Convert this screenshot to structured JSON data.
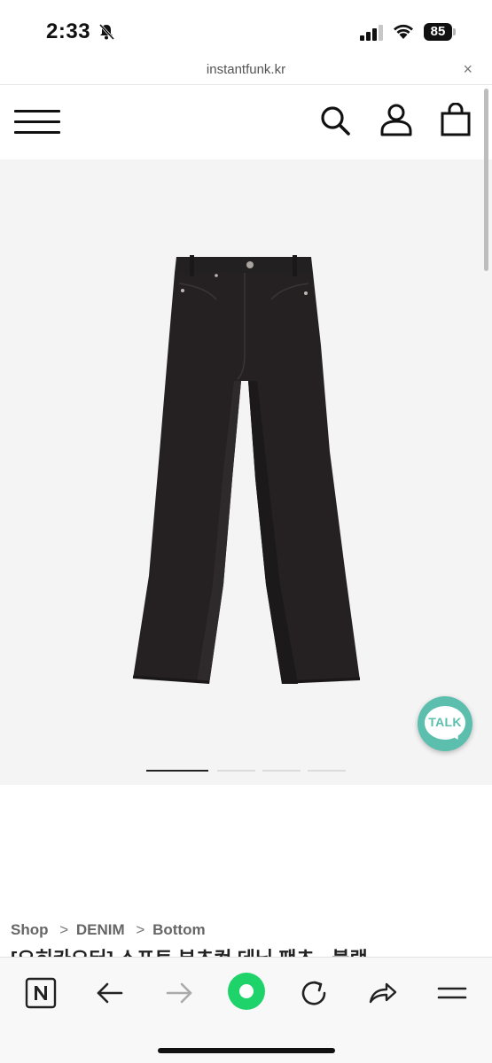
{
  "status_bar": {
    "time": "2:33",
    "battery": "85"
  },
  "url_bar": {
    "url": "instantfunk.kr",
    "close": "×"
  },
  "header": {
    "icons": [
      "menu-icon",
      "search-icon",
      "user-icon",
      "bag-icon"
    ]
  },
  "product": {
    "image": "black flared denim pants",
    "carousel_count": 4,
    "carousel_active": 0
  },
  "talk_button": {
    "label": "TALK",
    "color": "#5cbfae"
  },
  "breadcrumb": {
    "items": [
      "Shop",
      "DENIM",
      "Bottom"
    ],
    "separator": ">"
  },
  "product_title_partial": "[오히카오터] 스프트 부츠컷 데님 팬츠 - 블랙",
  "bottom_toolbar": {
    "icons": [
      "naver-n-icon",
      "back-arrow-icon",
      "forward-arrow-icon",
      "green-dot-icon",
      "refresh-icon",
      "share-icon",
      "menu-lines-icon"
    ],
    "accent": "#1fd36b"
  }
}
